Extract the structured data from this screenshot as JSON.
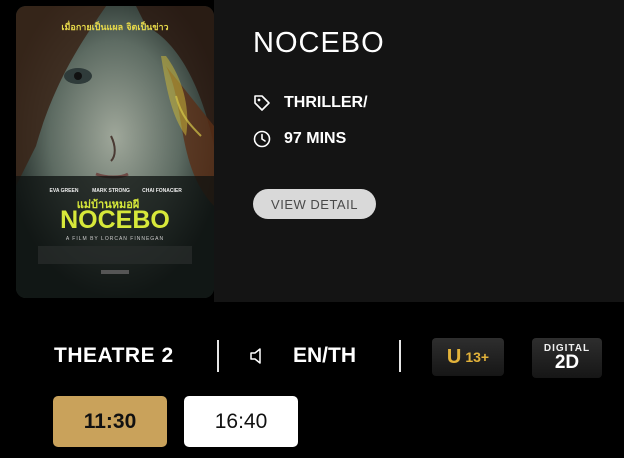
{
  "movie": {
    "title": "NOCEBO",
    "genre": "THRILLER/",
    "duration": "97 MINS",
    "view_detail_label": "VIEW DETAIL",
    "poster": {
      "tagline": "เมื่อกายเป็นแผล จิตเป็นข่าว",
      "cast": [
        "EVA GREEN",
        "MARK STRONG",
        "CHAI FONACIER"
      ],
      "thai_title": "แม่บ้านหมอผี",
      "title": "NOCEBO",
      "credit": "A FILM BY LORCAN FINNEGAN",
      "icons": {
        "tag": "tag-icon",
        "clock": "clock-icon"
      }
    }
  },
  "showtime_info": {
    "theatre": "THEATRE 2",
    "language": "EN/TH",
    "rating": {
      "letter": "U",
      "age": "13+"
    },
    "format": {
      "top": "DIGITAL",
      "bottom": "2D"
    }
  },
  "showtimes": [
    {
      "time": "11:30",
      "selected": true
    },
    {
      "time": "16:40",
      "selected": false
    }
  ],
  "colors": {
    "card_bg": "#141414",
    "selected_time": "#c9a25b",
    "rating_gold": "#e2b23a",
    "poster_title": "#d7e83a"
  }
}
